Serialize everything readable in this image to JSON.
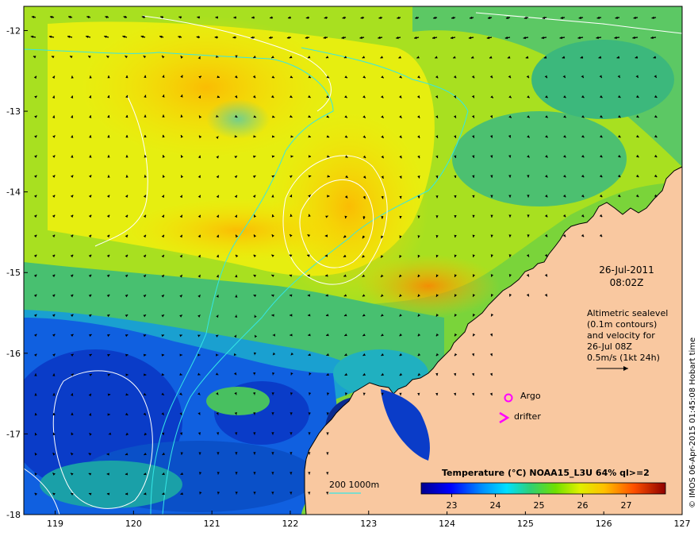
{
  "map": {
    "lon_ticks": [
      "119",
      "120",
      "121",
      "122",
      "123",
      "124",
      "125",
      "126",
      "127"
    ],
    "lat_ticks": [
      "-12",
      "-13",
      "-14",
      "-15",
      "-16",
      "-17",
      "-18"
    ],
    "lon_range": [
      118.6,
      127
    ],
    "lat_range": [
      -18,
      -11.7
    ],
    "date_line": "26-Jul-2011",
    "time_line": "08:02Z",
    "alt_lines": [
      "Altimetric sealevel",
      "(0.1m contours)",
      "and velocity for",
      "26-Jul 08Z",
      "0.5m/s (1kt 24h)"
    ],
    "argo_label": "Argo",
    "drifter_label": "drifter",
    "depth_label": "200  1000m",
    "credit": "© IMOS 06-Apr-2015 01:45:08 Hobart time",
    "colors": {
      "land": "#f9c8a0",
      "contour": "#ffffff",
      "isobath": "#35e6e6",
      "argo": "#ff00ff",
      "arrow": "#000000"
    }
  },
  "colorbar": {
    "title": "Temperature (°C) NOAA15_L3U 64% ql>=2",
    "ticks": [
      "23",
      "24",
      "25",
      "26",
      "27"
    ],
    "range": [
      22.3,
      27.9
    ],
    "tick_values": [
      23,
      24,
      25,
      26,
      27
    ]
  }
}
